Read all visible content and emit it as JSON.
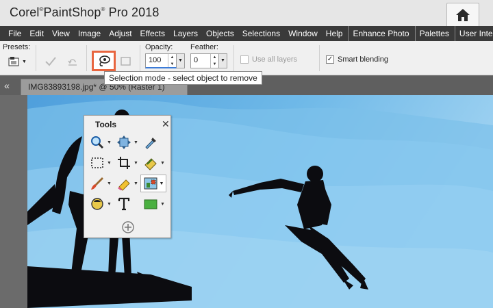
{
  "app": {
    "title": "Corel",
    "title_sup": "®",
    "title_rest": "PaintShop",
    "title_sup2": "®",
    "title_end": "Pro 2018"
  },
  "menu": [
    "File",
    "Edit",
    "View",
    "Image",
    "Adjust",
    "Effects",
    "Layers",
    "Objects",
    "Selections",
    "Window",
    "Help",
    "Enhance Photo",
    "Palettes",
    "User Interface"
  ],
  "options": {
    "presets_label": "Presets:",
    "opacity_label": "Opacity:",
    "opacity_value": "100",
    "feather_label": "Feather:",
    "feather_value": "0",
    "use_all_layers_label": "Use all layers",
    "use_all_layers_checked": false,
    "smart_blending_label": "Smart blending",
    "smart_blending_checked": true
  },
  "tooltip": "Selection mode - select object to remove",
  "document_tab": "IMG83893198.jpg* @  50% (Raster 1)",
  "tools_palette": {
    "title": "Tools",
    "tools": [
      "zoom-tool",
      "pan-tool",
      "dropper-tool",
      "selection-tool",
      "crop-tool",
      "straighten-tool",
      "paint-brush-tool",
      "eraser-tool",
      "object-remover-tool",
      "fill-tool",
      "text-tool",
      "rectangle-tool",
      "add-tool"
    ]
  },
  "colors": {
    "accent": "#e8653f",
    "menubar": "#3a3a3a",
    "sky_top": "#5aaae0",
    "sky_light": "#a9d8f2"
  }
}
